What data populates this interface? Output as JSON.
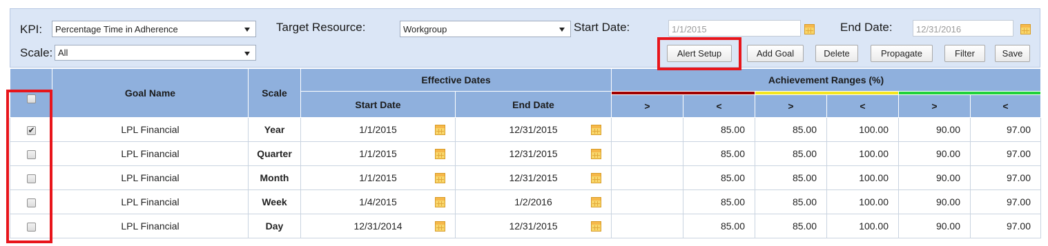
{
  "filters": {
    "kpi_label": "KPI:",
    "kpi_value": "Percentage Time in Adherence",
    "target_label": "Target Resource:",
    "target_value": "Workgroup",
    "start_label": "Start Date:",
    "start_value": "1/1/2015",
    "end_label": "End Date:",
    "end_value": "12/31/2016",
    "scale_label": "Scale:",
    "scale_value": "All"
  },
  "toolbar": {
    "alert_setup": "Alert Setup",
    "add_goal": "Add Goal",
    "delete": "Delete",
    "propagate": "Propagate",
    "filter": "Filter",
    "save": "Save"
  },
  "headers": {
    "goal_name": "Goal Name",
    "scale": "Scale",
    "effective_dates": "Effective Dates",
    "start_date": "Start Date",
    "end_date": "End Date",
    "achievement_ranges": "Achievement Ranges (%)",
    "gt": ">",
    "lt": "<"
  },
  "range_colors": [
    "#a00000",
    "#f5e61e",
    "#1fd23a"
  ],
  "rows": [
    {
      "checked": true,
      "goal": "LPL Financial",
      "scale": "Year",
      "start": "1/1/2015",
      "end": "12/31/2015",
      "r1_gt": "",
      "r1_lt": "85.00",
      "r2_gt": "85.00",
      "r2_lt": "100.00",
      "r3_gt": "90.00",
      "r3_lt": "97.00"
    },
    {
      "checked": false,
      "goal": "LPL Financial",
      "scale": "Quarter",
      "start": "1/1/2015",
      "end": "12/31/2015",
      "r1_gt": "",
      "r1_lt": "85.00",
      "r2_gt": "85.00",
      "r2_lt": "100.00",
      "r3_gt": "90.00",
      "r3_lt": "97.00"
    },
    {
      "checked": false,
      "goal": "LPL Financial",
      "scale": "Month",
      "start": "1/1/2015",
      "end": "12/31/2015",
      "r1_gt": "",
      "r1_lt": "85.00",
      "r2_gt": "85.00",
      "r2_lt": "100.00",
      "r3_gt": "90.00",
      "r3_lt": "97.00"
    },
    {
      "checked": false,
      "goal": "LPL Financial",
      "scale": "Week",
      "start": "1/4/2015",
      "end": "1/2/2016",
      "r1_gt": "",
      "r1_lt": "85.00",
      "r2_gt": "85.00",
      "r2_lt": "100.00",
      "r3_gt": "90.00",
      "r3_lt": "97.00"
    },
    {
      "checked": false,
      "goal": "LPL Financial",
      "scale": "Day",
      "start": "12/31/2014",
      "end": "12/31/2015",
      "r1_gt": "",
      "r1_lt": "85.00",
      "r2_gt": "85.00",
      "r2_lt": "100.00",
      "r3_gt": "90.00",
      "r3_lt": "97.00"
    }
  ]
}
